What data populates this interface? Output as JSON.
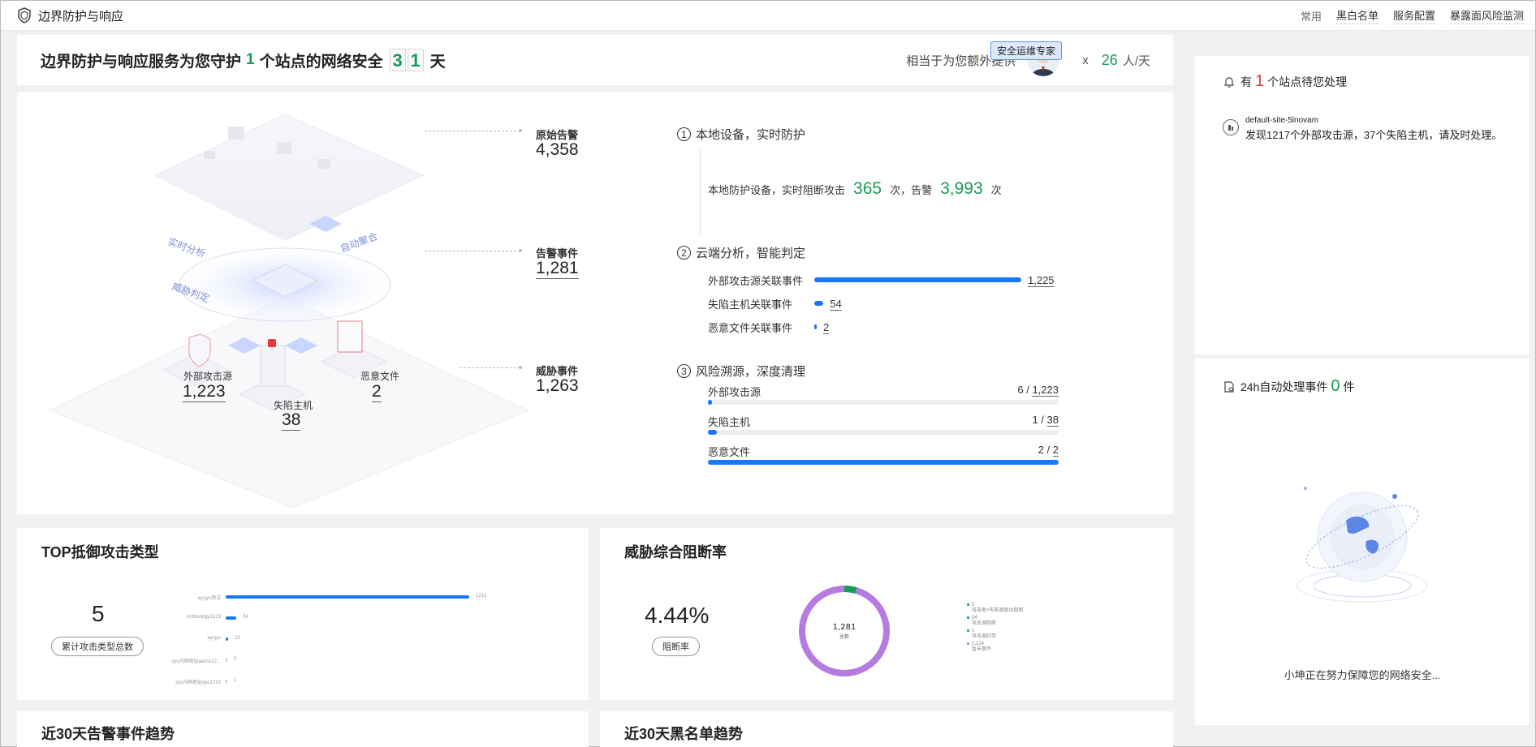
{
  "app": {
    "title": "边界防护与响应"
  },
  "nav": {
    "items": [
      "常用",
      "黑白名单",
      "服务配置",
      "暴露面风险监测"
    ]
  },
  "hero": {
    "prefix": "边界防护与响应服务为您守护",
    "sites": "1",
    "mid": "个站点的网络安全",
    "days": [
      "3",
      "1"
    ],
    "suffix": "天",
    "extra_label": "相当于为您额外提供",
    "expert_badge": "安全运维专家",
    "times": "x",
    "person_days": "26",
    "person_unit": "人/天"
  },
  "illustration": {
    "labels": {
      "realtime": "实时分析",
      "auto": "自动聚合",
      "threat": "威胁判定"
    },
    "external": {
      "label": "外部攻击源",
      "value": "1,223"
    },
    "host": {
      "label": "失陷主机",
      "value": "38"
    },
    "file": {
      "label": "恶意文件",
      "value": "2"
    }
  },
  "funnel": {
    "raw": {
      "label": "原始告警",
      "value": "4,358"
    },
    "alert": {
      "label": "告警事件",
      "value": "1,281"
    },
    "threat": {
      "label": "威胁事件",
      "value": "1,263"
    }
  },
  "section1": {
    "num": "1",
    "title": "本地设备，实时防护",
    "line_prefix": "本地防护设备，实时阻断攻击",
    "blocked": "365",
    "times1": "次，告警",
    "alerts": "3,993",
    "times2": "次"
  },
  "section2": {
    "num": "2",
    "title": "云端分析，智能判定",
    "rows": [
      {
        "label": "外部攻击源关联事件",
        "value": "1,225",
        "raw": 1225
      },
      {
        "label": "失陷主机关联事件",
        "value": "54",
        "raw": 54
      },
      {
        "label": "恶意文件关联事件",
        "value": "2",
        "raw": 2
      }
    ]
  },
  "section3": {
    "num": "3",
    "title": "风险溯源，深度清理",
    "rows": [
      {
        "label": "外部攻击源",
        "done": "6",
        "total": "1,223",
        "ratio": 0.0049
      },
      {
        "label": "失陷主机",
        "done": "1",
        "total": "38",
        "ratio": 0.026
      },
      {
        "label": "恶意文件",
        "done": "2",
        "total": "2",
        "ratio": 1.0
      }
    ]
  },
  "top_attack": {
    "title": "TOP抵御攻击类型",
    "count": "5",
    "count_label": "累计攻击类型总数",
    "bars": [
      {
        "label": "aycjyx测试",
        "value": 1213,
        "value_label": "1213"
      },
      {
        "label": "knthxcktgy1223",
        "value": 54,
        "value_label": "54"
      },
      {
        "label": "aycjyx",
        "value": 13,
        "value_label": "13"
      },
      {
        "label": "zyc内网地址aa\\/ck12...",
        "value": 2,
        "value_label": "2"
      },
      {
        "label": "zyc内网地址dyu1223",
        "value": 1,
        "value_label": "1"
      }
    ]
  },
  "block_rate": {
    "title": "威胁综合阻断率",
    "rate": "4.44%",
    "rate_label": "阻断率",
    "total": "1,281",
    "total_label": "总数",
    "legend": [
      {
        "value": "2",
        "label": "攻击者+失陷源联动阻断",
        "color": "#1a9a56",
        "raw": 2
      },
      {
        "value": "54",
        "label": "攻击源阻断",
        "color": "#1677ff",
        "raw": 54
      },
      {
        "value": "1",
        "label": "攻击源封禁",
        "color": "#1a9a56",
        "raw": 1
      },
      {
        "value": "1,224",
        "label": "暂未事件",
        "color": "#b57be0",
        "raw": 1224
      }
    ]
  },
  "trend_alert": {
    "title": "近30天告警事件趋势"
  },
  "trend_blacklist": {
    "title": "近30天黑名单趋势"
  },
  "side": {
    "pending_prefix": "有",
    "pending_count": "1",
    "pending_suffix": "个站点待您处理",
    "site_name": "default-site-5lnovam",
    "site_desc": "发现1217个外部攻击源，37个失陷主机，请及时处理。",
    "auto_prefix": "24h自动处理事件",
    "auto_count": "0",
    "auto_suffix": "件",
    "protect_msg": "小坤正在努力保障您的网络安全..."
  },
  "colors": {
    "accent": "#1677ff",
    "green": "#1a9a56",
    "red": "#e53935",
    "ring": "#b57be0"
  }
}
